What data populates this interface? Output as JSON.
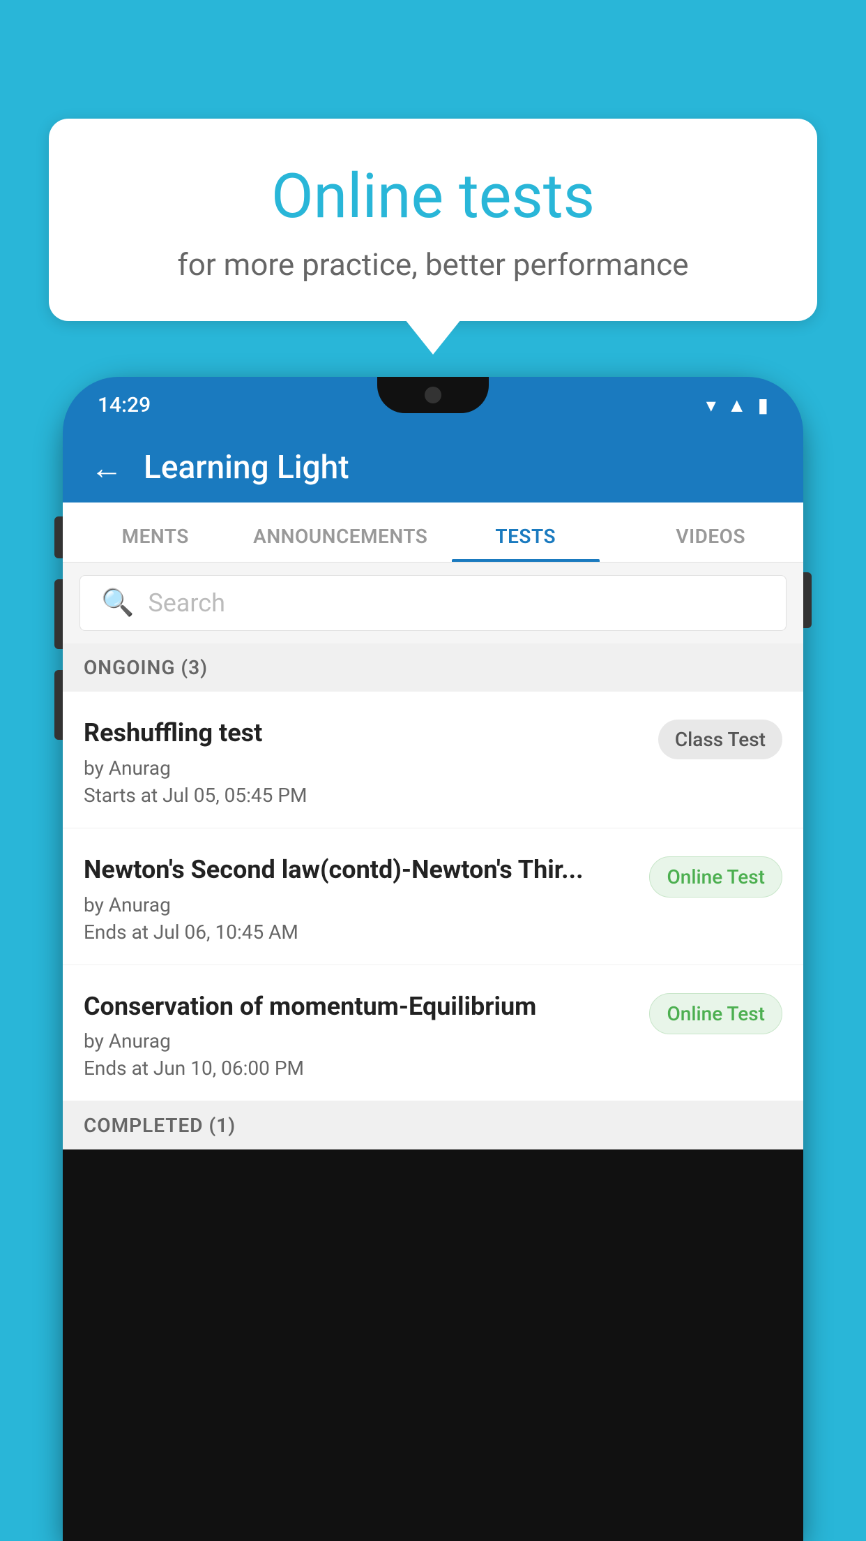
{
  "background": {
    "color": "#29b6d8"
  },
  "speech_bubble": {
    "title": "Online tests",
    "subtitle": "for more practice, better performance"
  },
  "phone": {
    "status_bar": {
      "time": "14:29",
      "icons": [
        "wifi",
        "signal",
        "battery"
      ]
    },
    "header": {
      "back_label": "←",
      "title": "Learning Light"
    },
    "tabs": [
      {
        "label": "MENTS",
        "active": false
      },
      {
        "label": "ANNOUNCEMENTS",
        "active": false
      },
      {
        "label": "TESTS",
        "active": true
      },
      {
        "label": "VIDEOS",
        "active": false
      }
    ],
    "search": {
      "placeholder": "Search"
    },
    "ongoing_section": {
      "label": "ONGOING (3)"
    },
    "test_items": [
      {
        "name": "Reshuffling test",
        "author": "by Anurag",
        "time_label": "Starts at",
        "time": "Jul 05, 05:45 PM",
        "badge": "Class Test",
        "badge_type": "class"
      },
      {
        "name": "Newton's Second law(contd)-Newton's Thir...",
        "author": "by Anurag",
        "time_label": "Ends at",
        "time": "Jul 06, 10:45 AM",
        "badge": "Online Test",
        "badge_type": "online"
      },
      {
        "name": "Conservation of momentum-Equilibrium",
        "author": "by Anurag",
        "time_label": "Ends at",
        "time": "Jun 10, 06:00 PM",
        "badge": "Online Test",
        "badge_type": "online"
      }
    ],
    "completed_section": {
      "label": "COMPLETED (1)"
    }
  }
}
